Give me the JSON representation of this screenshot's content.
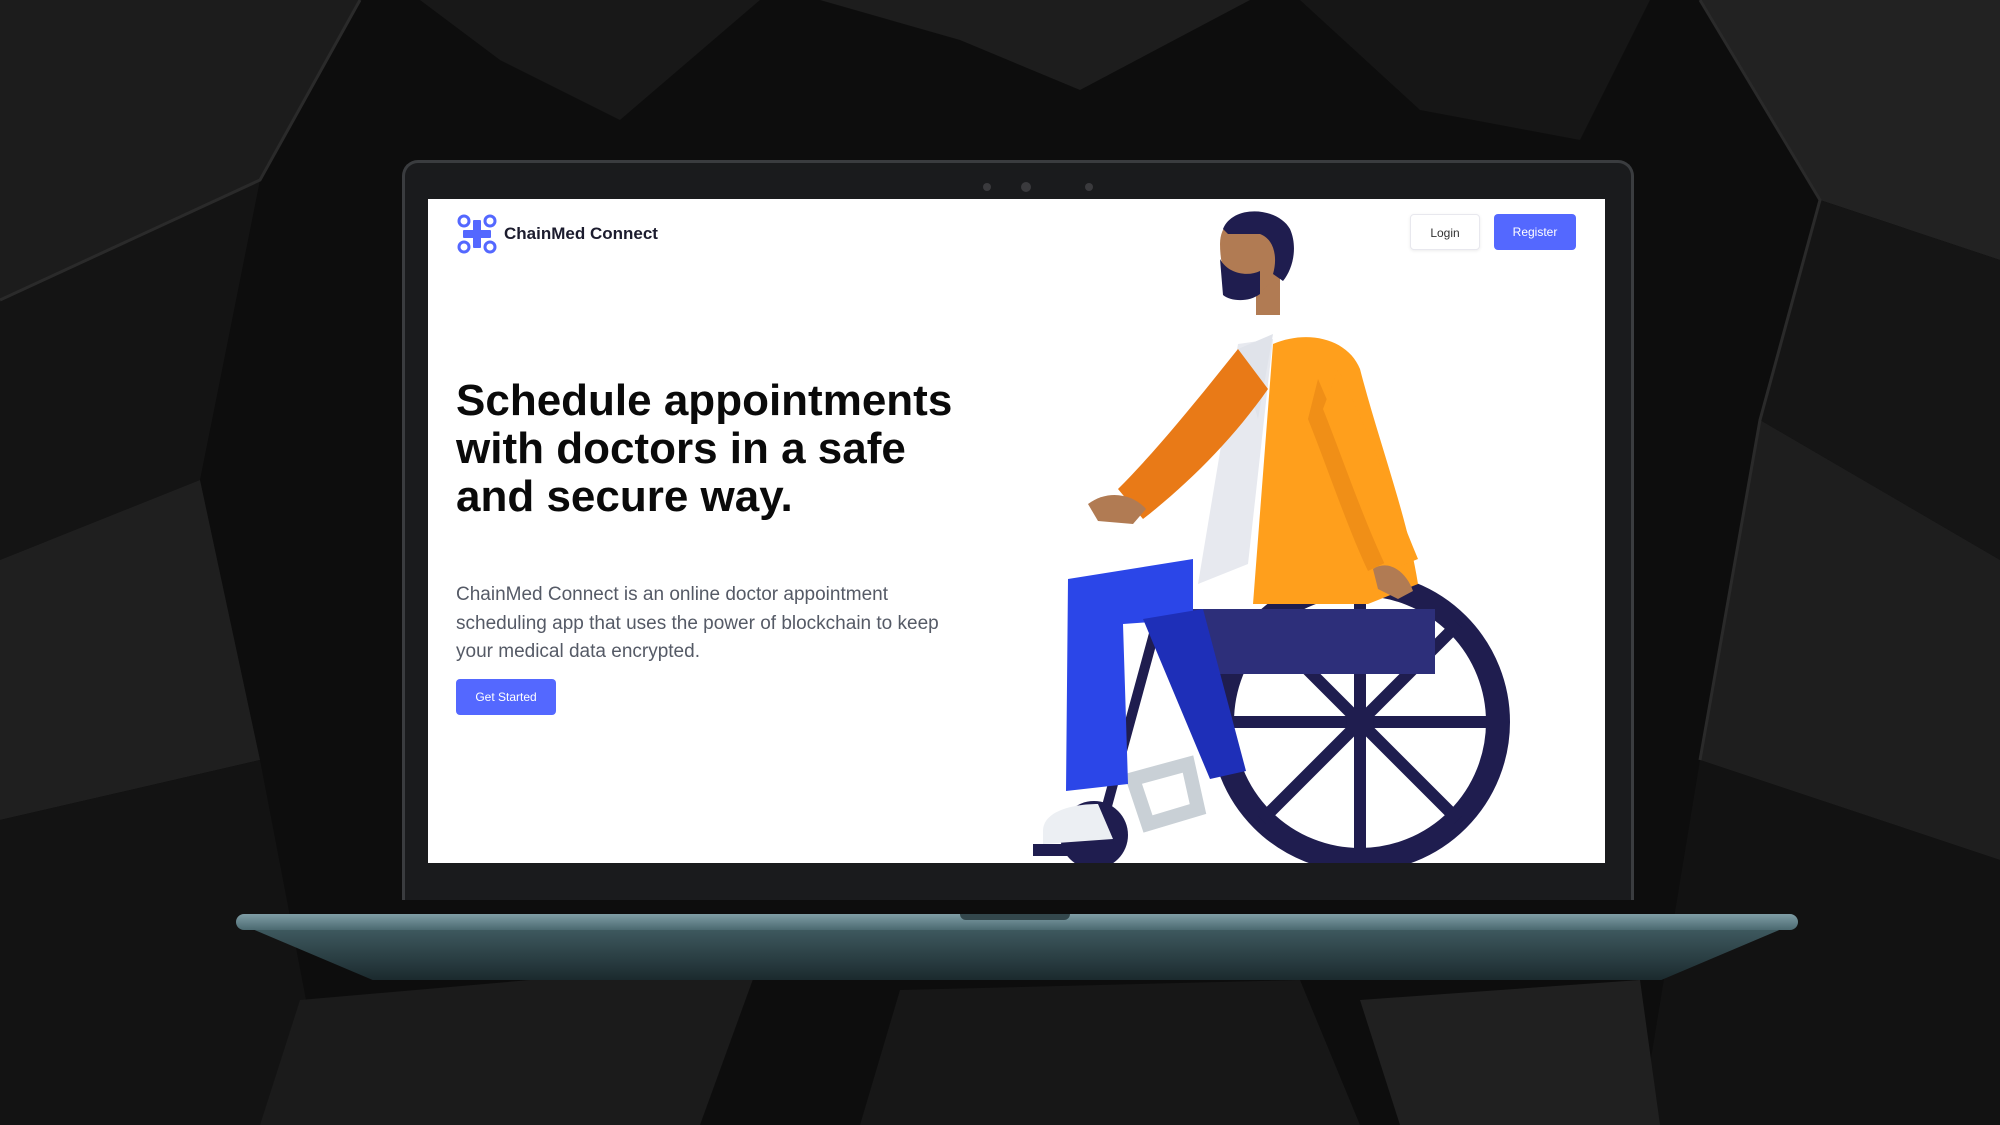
{
  "app": {
    "brand_name": "ChainMed Connect",
    "brand_color": "#5468ff"
  },
  "header": {
    "login_label": "Login",
    "register_label": "Register"
  },
  "hero": {
    "title": "Schedule appointments with doctors in a safe and secure way.",
    "description": "ChainMed Connect is an online doctor appointment scheduling app that uses the power of blockchain to keep your medical data encrypted.",
    "cta_label": "Get Started"
  },
  "icons": {
    "logo": "medical-cross-network-icon",
    "illustration": "person-in-wheelchair-illustration"
  }
}
